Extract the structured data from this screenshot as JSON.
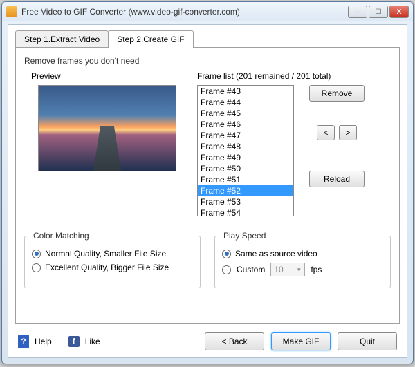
{
  "window": {
    "title": "Free Video to GIF Converter (www.video-gif-converter.com)"
  },
  "tabs": {
    "step1": "Step 1.Extract Video",
    "step2": "Step 2.Create GIF"
  },
  "section": {
    "removeFrames": "Remove frames you don't need",
    "preview": "Preview",
    "frameListLabel": "Frame list (201 remained / 201 total)"
  },
  "frames": {
    "remained": 201,
    "total": 201,
    "items": [
      "Frame #43",
      "Frame #44",
      "Frame #45",
      "Frame #46",
      "Frame #47",
      "Frame #48",
      "Frame #49",
      "Frame #50",
      "Frame #51",
      "Frame #52",
      "Frame #53",
      "Frame #54"
    ],
    "selectedIndex": 9
  },
  "buttons": {
    "remove": "Remove",
    "prev": "<",
    "next": ">",
    "reload": "Reload",
    "back": "< Back",
    "makeGif": "Make GIF",
    "quit": "Quit",
    "help": "Help",
    "like": "Like"
  },
  "colorMatching": {
    "legend": "Color Matching",
    "normal": "Normal Quality, Smaller File Size",
    "excellent": "Excellent Quality, Bigger File Size",
    "selected": "normal"
  },
  "playSpeed": {
    "legend": "Play Speed",
    "same": "Same as source video",
    "custom": "Custom",
    "value": "10",
    "unit": "fps",
    "selected": "same"
  }
}
